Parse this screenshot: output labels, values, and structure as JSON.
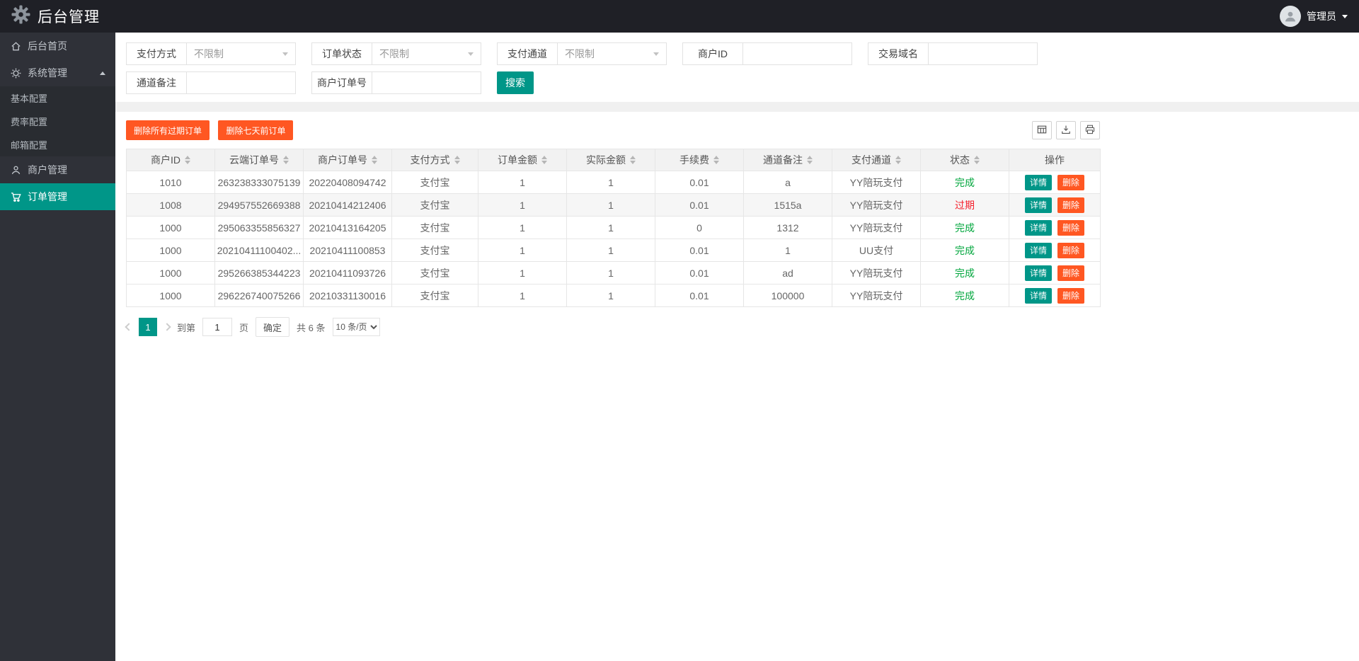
{
  "theme": {
    "accent": "#009688",
    "danger": "#ff5722",
    "status_success": "#00a63c",
    "status_expired": "#f5222d"
  },
  "header": {
    "title": "后台管理",
    "user_name": "管理员"
  },
  "sidebar": {
    "items": [
      {
        "icon": "home-icon",
        "label": "后台首页"
      },
      {
        "icon": "gear-icon",
        "label": "系统管理",
        "expanded": true,
        "children": [
          {
            "label": "基本配置"
          },
          {
            "label": "费率配置"
          },
          {
            "label": "邮箱配置"
          }
        ]
      },
      {
        "icon": "user-icon",
        "label": "商户管理"
      },
      {
        "icon": "cart-icon",
        "label": "订单管理",
        "active": true
      }
    ]
  },
  "filters": {
    "fields": [
      {
        "label": "支付方式",
        "type": "select",
        "value": "不限制"
      },
      {
        "label": "订单状态",
        "type": "select",
        "value": "不限制"
      },
      {
        "label": "支付通道",
        "type": "select",
        "value": "不限制"
      },
      {
        "label": "商户ID",
        "type": "text",
        "value": ""
      },
      {
        "label": "交易域名",
        "type": "text",
        "value": ""
      },
      {
        "label": "通道备注",
        "type": "text",
        "value": ""
      },
      {
        "label": "商户订单号",
        "type": "text",
        "value": ""
      }
    ],
    "search_button_label": "搜索"
  },
  "toolbar": {
    "delete_expired_label": "删除所有过期订单",
    "delete_before7days_label": "删除七天前订单",
    "icons": [
      "table-columns-icon",
      "export-icon",
      "print-icon"
    ]
  },
  "table": {
    "columns": [
      {
        "key": "merchant_id",
        "label": "商户ID",
        "sortable": true
      },
      {
        "key": "cloud_order_no",
        "label": "云端订单号",
        "sortable": true
      },
      {
        "key": "merchant_order_no",
        "label": "商户订单号",
        "sortable": true
      },
      {
        "key": "pay_method",
        "label": "支付方式",
        "sortable": true
      },
      {
        "key": "order_amount",
        "label": "订单金额",
        "sortable": true
      },
      {
        "key": "actual_amount",
        "label": "实际金额",
        "sortable": true
      },
      {
        "key": "fee",
        "label": "手续费",
        "sortable": true
      },
      {
        "key": "channel_note",
        "label": "通道备注",
        "sortable": true
      },
      {
        "key": "pay_channel",
        "label": "支付通道",
        "sortable": true
      },
      {
        "key": "status",
        "label": "状态",
        "sortable": true
      },
      {
        "key": "actions",
        "label": "操作",
        "sortable": false
      }
    ],
    "rows": [
      {
        "merchant_id": "1010",
        "cloud_order_no": "263238333075139",
        "merchant_order_no": "20220408094742",
        "pay_method": "支付宝",
        "order_amount": "1",
        "actual_amount": "1",
        "fee": "0.01",
        "channel_note": "a",
        "pay_channel": "YY陪玩支付",
        "status": "完成",
        "status_type": "success",
        "highlighted": false
      },
      {
        "merchant_id": "1008",
        "cloud_order_no": "294957552669388",
        "merchant_order_no": "20210414212406",
        "pay_method": "支付宝",
        "order_amount": "1",
        "actual_amount": "1",
        "fee": "0.01",
        "channel_note": "1515a",
        "pay_channel": "YY陪玩支付",
        "status": "过期",
        "status_type": "expired",
        "highlighted": true
      },
      {
        "merchant_id": "1000",
        "cloud_order_no": "295063355856327",
        "merchant_order_no": "20210413164205",
        "pay_method": "支付宝",
        "order_amount": "1",
        "actual_amount": "1",
        "fee": "0",
        "channel_note": "1312",
        "pay_channel": "YY陪玩支付",
        "status": "完成",
        "status_type": "success",
        "highlighted": false
      },
      {
        "merchant_id": "1000",
        "cloud_order_no": "20210411100402...",
        "merchant_order_no": "20210411100853",
        "pay_method": "支付宝",
        "order_amount": "1",
        "actual_amount": "1",
        "fee": "0.01",
        "channel_note": "1",
        "pay_channel": "UU支付",
        "status": "完成",
        "status_type": "success",
        "highlighted": false
      },
      {
        "merchant_id": "1000",
        "cloud_order_no": "295266385344223",
        "merchant_order_no": "20210411093726",
        "pay_method": "支付宝",
        "order_amount": "1",
        "actual_amount": "1",
        "fee": "0.01",
        "channel_note": "ad",
        "pay_channel": "YY陪玩支付",
        "status": "完成",
        "status_type": "success",
        "highlighted": false
      },
      {
        "merchant_id": "1000",
        "cloud_order_no": "296226740075266",
        "merchant_order_no": "20210331130016",
        "pay_method": "支付宝",
        "order_amount": "1",
        "actual_amount": "1",
        "fee": "0.01",
        "channel_note": "100000",
        "pay_channel": "YY陪玩支付",
        "status": "完成",
        "status_type": "success",
        "highlighted": false
      }
    ],
    "detail_label": "详情",
    "delete_label": "删除"
  },
  "pagination": {
    "current_page": "1",
    "jump_label": "到第",
    "jump_value": "1",
    "page_unit_label": "页",
    "confirm_label": "确定",
    "total_label": "共 6 条",
    "page_size_label": "10 条/页"
  }
}
